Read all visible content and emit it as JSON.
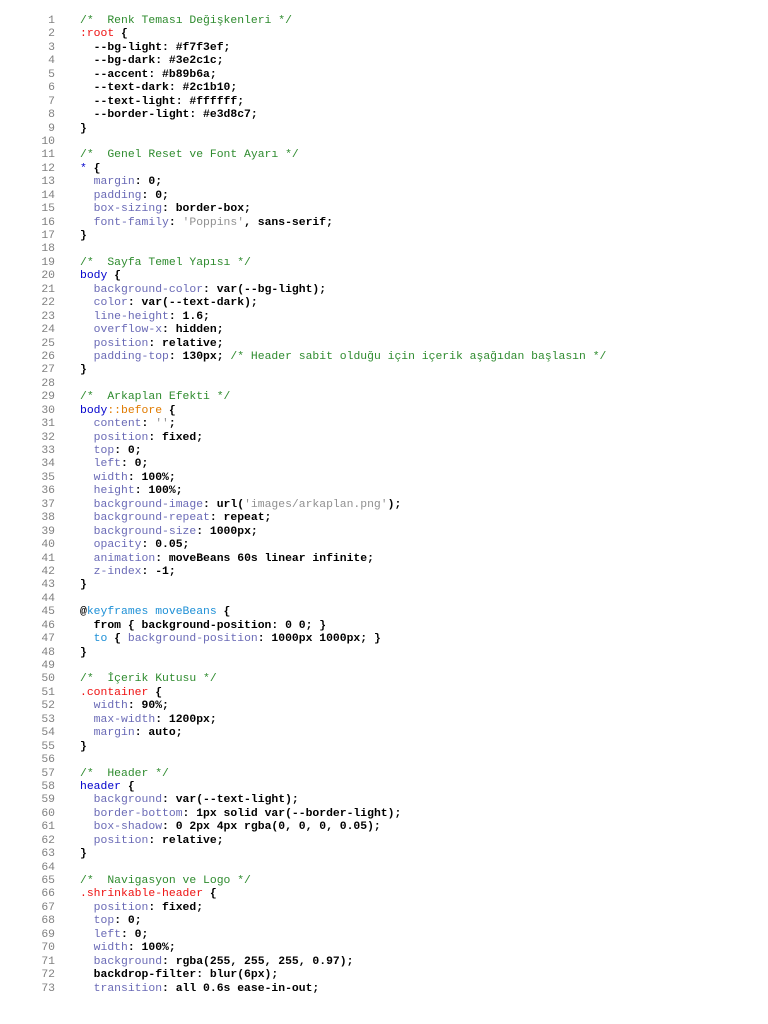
{
  "editor": {
    "colors": {
      "comment": "#2e8b2e",
      "selector": "#0000cc",
      "class_selector": "#ee1111",
      "property": "#6a6ab6",
      "string": "#909090",
      "pseudo_element": "#e07b00",
      "at_rule": "#1c8fd6",
      "line_number": "#808080"
    },
    "lines": [
      [
        [
          "comment",
          "/*  Renk Teması Değişkenleri */"
        ]
      ],
      [
        [
          "class",
          ":root"
        ],
        [
          "plain",
          " {"
        ]
      ],
      [
        [
          "plain",
          "  --bg-light: #f7f3ef;"
        ]
      ],
      [
        [
          "plain",
          "  --bg-dark: #3e2c1c;"
        ]
      ],
      [
        [
          "plain",
          "  --accent: #b89b6a;"
        ]
      ],
      [
        [
          "plain",
          "  --text-dark: #2c1b10;"
        ]
      ],
      [
        [
          "plain",
          "  --text-light: #ffffff;"
        ]
      ],
      [
        [
          "plain",
          "  --border-light: #e3d8c7;"
        ]
      ],
      [
        [
          "plain",
          "}"
        ]
      ],
      [],
      [
        [
          "comment",
          "/*  Genel Reset ve Font Ayarı */"
        ]
      ],
      [
        [
          "selector",
          "*"
        ],
        [
          "plain",
          " {"
        ]
      ],
      [
        [
          "property",
          "  margin"
        ],
        [
          "plain",
          ": 0;"
        ]
      ],
      [
        [
          "property",
          "  padding"
        ],
        [
          "plain",
          ": 0;"
        ]
      ],
      [
        [
          "property",
          "  box-sizing"
        ],
        [
          "plain",
          ": border-box;"
        ]
      ],
      [
        [
          "property",
          "  font-family"
        ],
        [
          "plain",
          ": "
        ],
        [
          "string",
          "'Poppins'"
        ],
        [
          "plain",
          ", sans-serif;"
        ]
      ],
      [
        [
          "plain",
          "}"
        ]
      ],
      [],
      [
        [
          "comment",
          "/*  Sayfa Temel Yapısı */"
        ]
      ],
      [
        [
          "selector",
          "body"
        ],
        [
          "plain",
          " {"
        ]
      ],
      [
        [
          "property",
          "  background-color"
        ],
        [
          "plain",
          ": var(--bg-light);"
        ]
      ],
      [
        [
          "property",
          "  color"
        ],
        [
          "plain",
          ": var(--text-dark);"
        ]
      ],
      [
        [
          "property",
          "  line-height"
        ],
        [
          "plain",
          ": 1.6;"
        ]
      ],
      [
        [
          "property",
          "  overflow-x"
        ],
        [
          "plain",
          ": hidden;"
        ]
      ],
      [
        [
          "property",
          "  position"
        ],
        [
          "plain",
          ": relative;"
        ]
      ],
      [
        [
          "property",
          "  padding-top"
        ],
        [
          "plain",
          ": 130px; "
        ],
        [
          "comment",
          "/* Header sabit olduğu için içerik aşağıdan başlasın */"
        ]
      ],
      [
        [
          "plain",
          "}"
        ]
      ],
      [],
      [
        [
          "comment",
          "/*  Arkaplan Efekti */"
        ]
      ],
      [
        [
          "selector",
          "body"
        ],
        [
          "pseudo",
          "::before"
        ],
        [
          "plain",
          " {"
        ]
      ],
      [
        [
          "property",
          "  content"
        ],
        [
          "plain",
          ": "
        ],
        [
          "string",
          "''"
        ],
        [
          "plain",
          ";"
        ]
      ],
      [
        [
          "property",
          "  position"
        ],
        [
          "plain",
          ": fixed;"
        ]
      ],
      [
        [
          "property",
          "  top"
        ],
        [
          "plain",
          ": 0;"
        ]
      ],
      [
        [
          "property",
          "  left"
        ],
        [
          "plain",
          ": 0;"
        ]
      ],
      [
        [
          "property",
          "  width"
        ],
        [
          "plain",
          ": 100%;"
        ]
      ],
      [
        [
          "property",
          "  height"
        ],
        [
          "plain",
          ": 100%;"
        ]
      ],
      [
        [
          "property",
          "  background-image"
        ],
        [
          "plain",
          ": url("
        ],
        [
          "string",
          "'images/arkaplan.png'"
        ],
        [
          "plain",
          ");"
        ]
      ],
      [
        [
          "property",
          "  background-repeat"
        ],
        [
          "plain",
          ": repeat;"
        ]
      ],
      [
        [
          "property",
          "  background-size"
        ],
        [
          "plain",
          ": 1000px;"
        ]
      ],
      [
        [
          "property",
          "  opacity"
        ],
        [
          "plain",
          ": 0.05;"
        ]
      ],
      [
        [
          "property",
          "  animation"
        ],
        [
          "plain",
          ": moveBeans 60s linear infinite;"
        ]
      ],
      [
        [
          "property",
          "  z-index"
        ],
        [
          "plain",
          ": -1;"
        ]
      ],
      [
        [
          "plain",
          "}"
        ]
      ],
      [],
      [
        [
          "plain",
          "@"
        ],
        [
          "at",
          "keyframes moveBeans"
        ],
        [
          "plain",
          " {"
        ]
      ],
      [
        [
          "plain",
          "  from { background-position: 0 0; }"
        ]
      ],
      [
        [
          "at",
          "  to"
        ],
        [
          "plain",
          " { "
        ],
        [
          "property",
          "background-position"
        ],
        [
          "plain",
          ": 1000px 1000px; }"
        ]
      ],
      [
        [
          "plain",
          "}"
        ]
      ],
      [],
      [
        [
          "comment",
          "/*  İçerik Kutusu */"
        ]
      ],
      [
        [
          "class",
          ".container"
        ],
        [
          "plain",
          " {"
        ]
      ],
      [
        [
          "property",
          "  width"
        ],
        [
          "plain",
          ": 90%;"
        ]
      ],
      [
        [
          "property",
          "  max-width"
        ],
        [
          "plain",
          ": 1200px;"
        ]
      ],
      [
        [
          "property",
          "  margin"
        ],
        [
          "plain",
          ": auto;"
        ]
      ],
      [
        [
          "plain",
          "}"
        ]
      ],
      [],
      [
        [
          "comment",
          "/*  Header */"
        ]
      ],
      [
        [
          "selector",
          "header"
        ],
        [
          "plain",
          " {"
        ]
      ],
      [
        [
          "property",
          "  background"
        ],
        [
          "plain",
          ": var(--text-light);"
        ]
      ],
      [
        [
          "property",
          "  border-bottom"
        ],
        [
          "plain",
          ": 1px solid var(--border-light);"
        ]
      ],
      [
        [
          "property",
          "  box-shadow"
        ],
        [
          "plain",
          ": 0 2px 4px rgba(0, 0, 0, 0.05);"
        ]
      ],
      [
        [
          "property",
          "  position"
        ],
        [
          "plain",
          ": relative;"
        ]
      ],
      [
        [
          "plain",
          "}"
        ]
      ],
      [],
      [
        [
          "comment",
          "/*  Navigasyon ve Logo */"
        ]
      ],
      [
        [
          "class",
          ".shrinkable-header"
        ],
        [
          "plain",
          " {"
        ]
      ],
      [
        [
          "property",
          "  position"
        ],
        [
          "plain",
          ": fixed;"
        ]
      ],
      [
        [
          "property",
          "  top"
        ],
        [
          "plain",
          ": 0;"
        ]
      ],
      [
        [
          "property",
          "  left"
        ],
        [
          "plain",
          ": 0;"
        ]
      ],
      [
        [
          "property",
          "  width"
        ],
        [
          "plain",
          ": 100%;"
        ]
      ],
      [
        [
          "property",
          "  background"
        ],
        [
          "plain",
          ": rgba(255, 255, 255, 0.97);"
        ]
      ],
      [
        [
          "plain",
          "  backdrop-filter: blur(6px);"
        ]
      ],
      [
        [
          "property",
          "  transition"
        ],
        [
          "plain",
          ": all 0.6s ease-in-out;"
        ]
      ]
    ]
  }
}
